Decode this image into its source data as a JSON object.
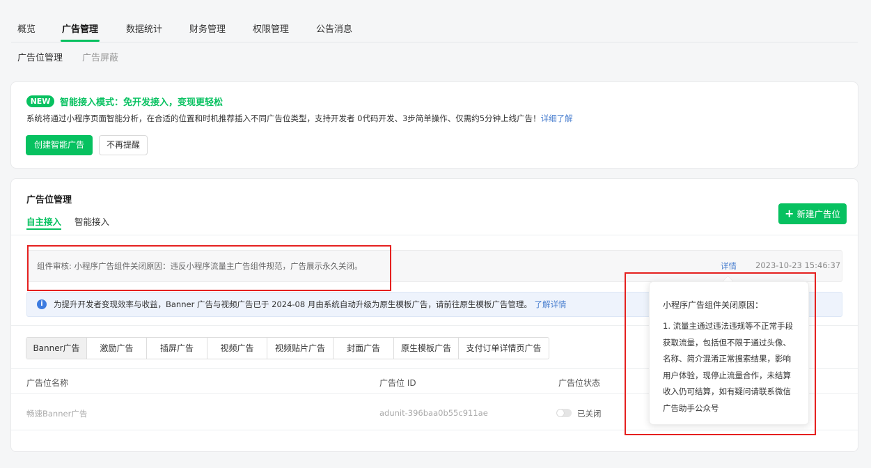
{
  "top_nav": {
    "items": [
      "概览",
      "广告管理",
      "数据统计",
      "财务管理",
      "权限管理",
      "公告消息"
    ],
    "active_index": 1
  },
  "sub_nav": {
    "items": [
      "广告位管理",
      "广告屏蔽"
    ],
    "active_index": 0
  },
  "promo": {
    "badge": "NEW",
    "title": "智能接入模式：免开发接入，变现更轻松",
    "description": "系统将通过小程序页面智能分析，在合适的位置和时机推荐插入不同广告位类型，支持开发者 0代码开发、3步简单操作、仅需约5分钟上线广告！",
    "link": "详细了解",
    "create_button": "创建智能广告",
    "dismiss_button": "不再提醒"
  },
  "ad_management": {
    "title": "广告位管理",
    "tabs": [
      "自主接入",
      "智能接入"
    ],
    "active_tab": 0,
    "new_button_icon": "plus-icon",
    "new_button": "新建广告位",
    "notice": {
      "text": "组件审核: 小程序广告组件关闭原因：违反小程序流量主广告组件规范，广告展示永久关闭。",
      "detail_link": "详情",
      "time": "2023-10-23 15:46:37"
    },
    "info": {
      "icon": "info-icon",
      "text": "为提升开发者变现效率与收益，Banner 广告与视频广告已于 2024-08 月由系统自动升级为原生模板广告，请前往原生模板广告管理。",
      "link": "了解详情"
    },
    "ad_types": [
      "Banner广告",
      "激励广告",
      "插屏广告",
      "视频广告",
      "视频贴片广告",
      "封面广告",
      "原生模板广告",
      "支付订单详情页广告"
    ],
    "active_type": 0,
    "table": {
      "columns": [
        "广告位名称",
        "广告位 ID",
        "广告位状态"
      ],
      "rows": [
        {
          "name": "畅速Banner广告",
          "id": "adunit-396baa0b55c911ae",
          "status": "已关闭",
          "enabled": false
        }
      ]
    }
  },
  "tooltip": {
    "title": "小程序广告组件关闭原因：",
    "body": "1. 流量主通过违法违规等不正常手段获取流量，包括但不限于通过头像、名称、简介混淆正常搜索结果，影响用户体验，现停止流量合作，未结算收入仍可结算，如有疑问请联系微信广告助手公众号"
  },
  "colors": {
    "accent": "#07c160",
    "link": "#4a7fcf",
    "highlight": "#e5201f",
    "info": "#3c7be0"
  }
}
